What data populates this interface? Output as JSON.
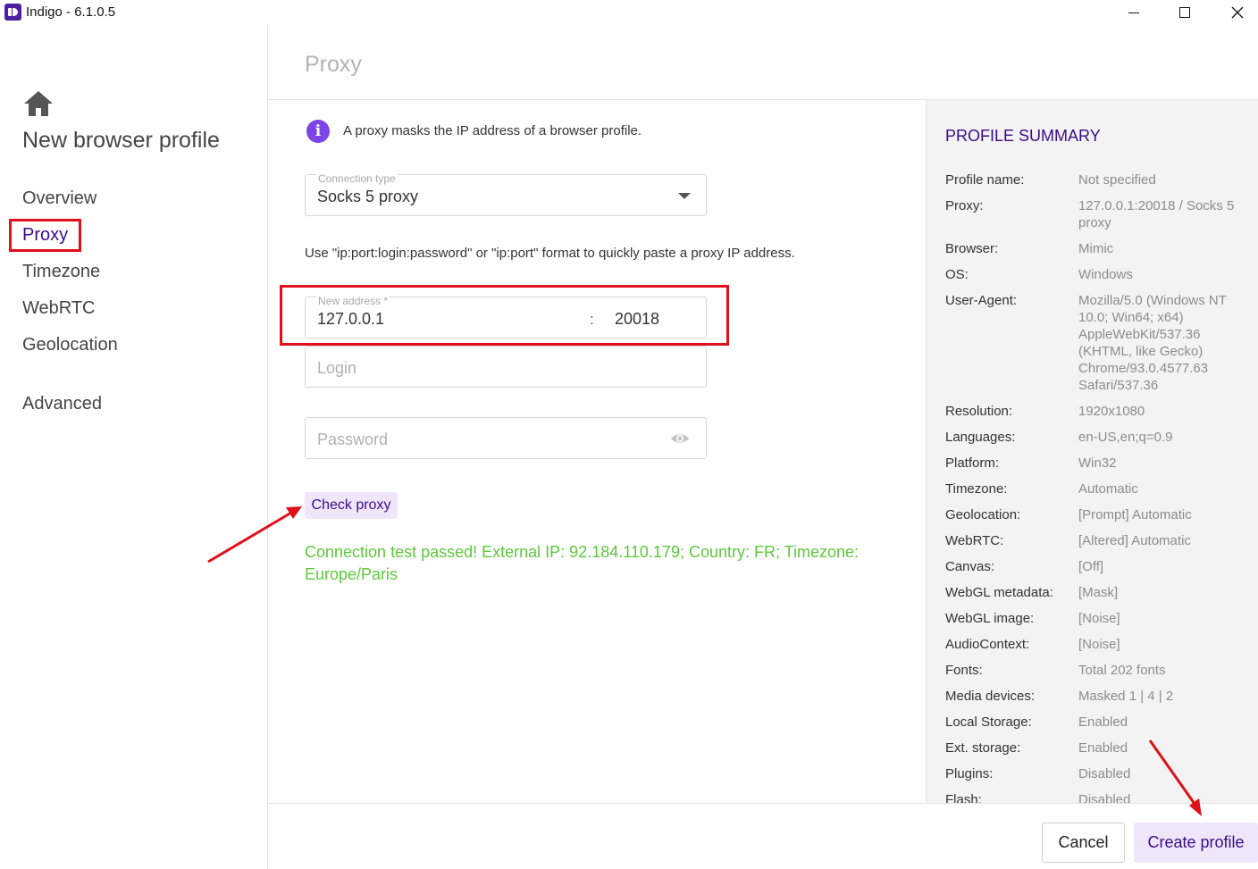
{
  "window": {
    "title": "Indigo - 6.1.0.5"
  },
  "sidebar": {
    "title": "New browser profile",
    "items": [
      {
        "label": "Overview"
      },
      {
        "label": "Proxy"
      },
      {
        "label": "Timezone"
      },
      {
        "label": "WebRTC"
      },
      {
        "label": "Geolocation"
      },
      {
        "label": "Advanced"
      }
    ],
    "active_item": "Proxy"
  },
  "header": {
    "title": "Proxy"
  },
  "form": {
    "info_text": "A proxy masks the IP address of a browser profile.",
    "connection_type": {
      "label": "Connection type",
      "value": "Socks 5 proxy"
    },
    "hint": "Use \"ip:port:login:password\" or \"ip:port\" format to quickly paste a proxy IP address.",
    "address": {
      "label": "New address *",
      "ip": "127.0.0.1",
      "separator": ":",
      "port": "20018"
    },
    "login": {
      "placeholder": "Login"
    },
    "password": {
      "placeholder": "Password"
    },
    "check_button": "Check proxy",
    "result": "Connection test passed! External IP: 92.184.110.179; Country: FR; Timezone: Europe/Paris"
  },
  "summary": {
    "title": "PROFILE SUMMARY",
    "rows": [
      {
        "key": "Profile name:",
        "value": "Not specified"
      },
      {
        "key": "Proxy:",
        "value": "127.0.0.1:20018 / Socks 5 proxy"
      },
      {
        "key": "Browser:",
        "value": "Mimic"
      },
      {
        "key": "OS:",
        "value": "Windows"
      },
      {
        "key": "User-Agent:",
        "value": "Mozilla/5.0 (Windows NT 10.0; Win64; x64) AppleWebKit/537.36 (KHTML, like Gecko) Chrome/93.0.4577.63 Safari/537.36"
      },
      {
        "key": "Resolution:",
        "value": "1920x1080"
      },
      {
        "key": "Languages:",
        "value": "en-US,en;q=0.9"
      },
      {
        "key": "Platform:",
        "value": "Win32"
      },
      {
        "key": "Timezone:",
        "value": "Automatic"
      },
      {
        "key": "Geolocation:",
        "value": "[Prompt] Automatic"
      },
      {
        "key": "WebRTC:",
        "value": "[Altered] Automatic"
      },
      {
        "key": "Canvas:",
        "value": "[Off]"
      },
      {
        "key": "WebGL metadata:",
        "value": "[Mask]"
      },
      {
        "key": "WebGL image:",
        "value": "[Noise]"
      },
      {
        "key": "AudioContext:",
        "value": "[Noise]"
      },
      {
        "key": "Fonts:",
        "value": "Total 202 fonts"
      },
      {
        "key": "Media devices:",
        "value": "Masked 1 | 4 | 2"
      },
      {
        "key": "Local Storage:",
        "value": "Enabled"
      },
      {
        "key": "Ext. storage:",
        "value": "Enabled"
      },
      {
        "key": "Plugins:",
        "value": "Disabled"
      },
      {
        "key": "Flash:",
        "value": "Disabled"
      }
    ]
  },
  "footer": {
    "cancel_label": "Cancel",
    "create_label": "Create profile"
  },
  "colors": {
    "accent": "#3a0b89",
    "success": "#5cc83b",
    "annotation": "#e0101a"
  }
}
